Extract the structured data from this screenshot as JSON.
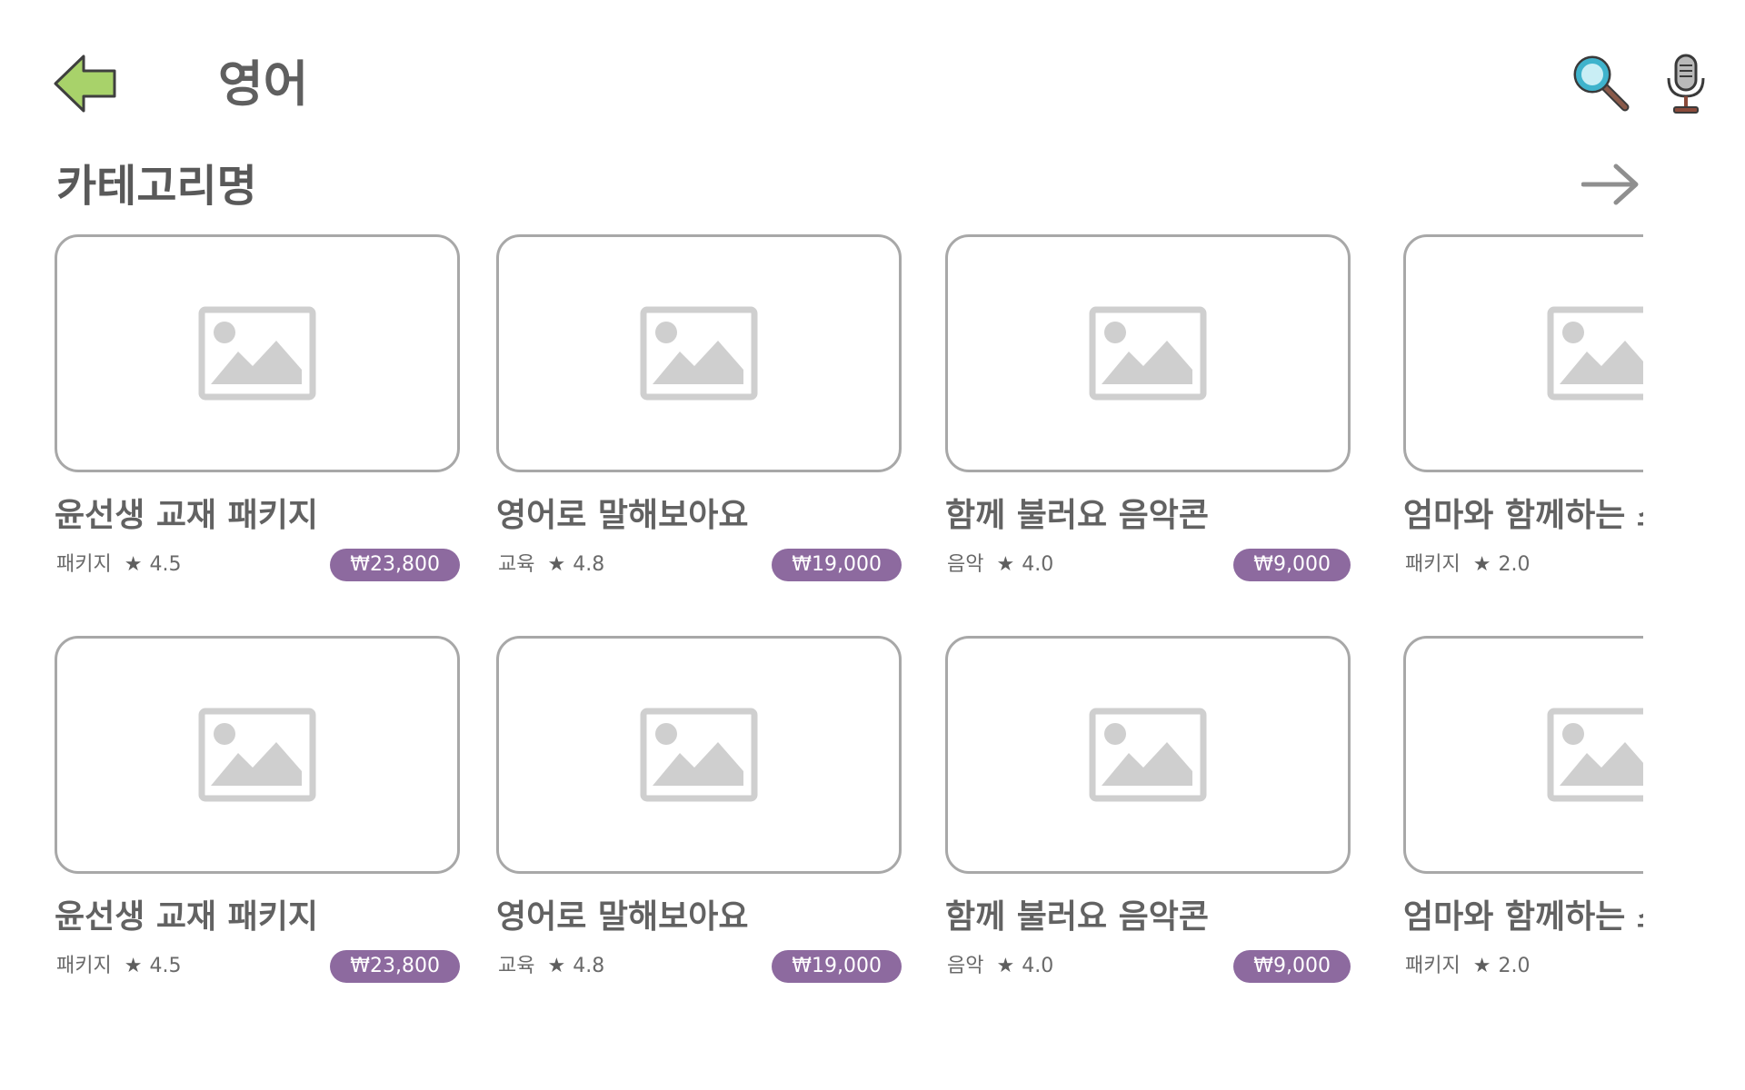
{
  "header": {
    "title": "영어",
    "back_icon": "back-arrow-icon",
    "search_icon": "search-icon",
    "mic_icon": "microphone-icon"
  },
  "section": {
    "title": "카테고리명",
    "more_icon": "arrow-right-icon"
  },
  "colors": {
    "price_badge": "#8d6a9f",
    "back_arrow": "#a8d26a",
    "card_border": "#a8a8a8"
  },
  "rows": [
    {
      "cards": [
        {
          "title": "윤선생 교재 패키지",
          "category": "패키지",
          "rating": "4.5",
          "price": "₩23,800"
        },
        {
          "title": "영어로 말해보아요",
          "category": "교육",
          "rating": "4.8",
          "price": "₩19,000"
        },
        {
          "title": "함께 불러요 음악콘",
          "category": "음악",
          "rating": "4.0",
          "price": "₩9,000"
        },
        {
          "title": "엄마와 함께하는 스",
          "category": "패키지",
          "rating": "2.0",
          "price": ""
        }
      ]
    },
    {
      "cards": [
        {
          "title": "윤선생 교재 패키지",
          "category": "패키지",
          "rating": "4.5",
          "price": "₩23,800"
        },
        {
          "title": "영어로 말해보아요",
          "category": "교육",
          "rating": "4.8",
          "price": "₩19,000"
        },
        {
          "title": "함께 불러요 음악콘",
          "category": "음악",
          "rating": "4.0",
          "price": "₩9,000"
        },
        {
          "title": "엄마와 함께하는 스",
          "category": "패키지",
          "rating": "2.0",
          "price": ""
        }
      ]
    }
  ]
}
